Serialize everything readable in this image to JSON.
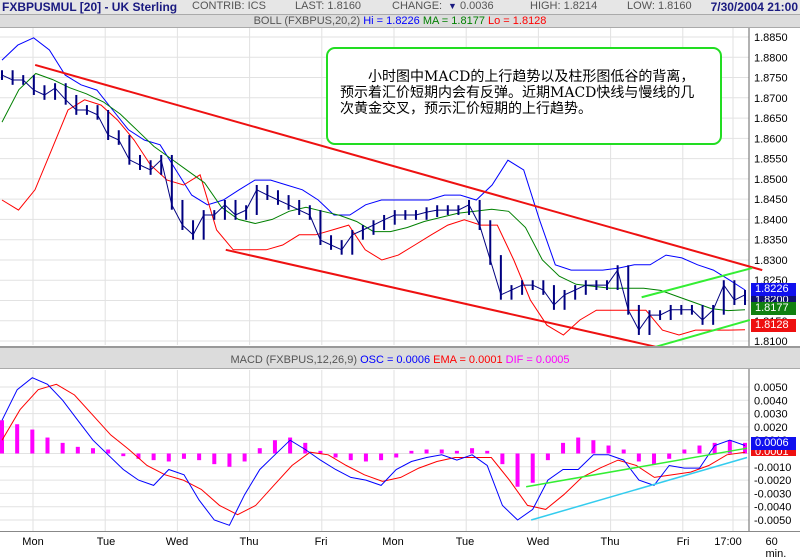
{
  "header": {
    "title": "FXBPUSMUL [20] - UK Sterling",
    "contrib": "CONTRIB: ICS",
    "last": "LAST: 1.8160",
    "change_label": "CHANGE:",
    "change_icon": "triangle-down-icon",
    "change_value": "0.0036",
    "high": "HIGH: 1.8214",
    "low": "LOW: 1.8160",
    "datetime": "7/30/2004 21:00"
  },
  "boll_bar": {
    "label": "BOLL (FXBPUS,20,2)",
    "hi": "Hi = 1.8226",
    "ma": "MA = 1.8177",
    "lo": "Lo = 1.8128"
  },
  "macd_bar": {
    "label": "MACD (FXBPUS,12,26,9)",
    "osc": "OSC = 0.0006",
    "ema": "EMA = 0.0001",
    "dif": "DIF = 0.0005"
  },
  "annotation": "小时图中MACD的上行趋势以及柱形图低谷的背离，预示着汇价短期内会有反弹。近期MACD快线与慢线的几次黄金交叉，预示汇价短期的上行趋势。",
  "price_boxes": [
    {
      "text": "1.8226",
      "color": "#1010ee"
    },
    {
      "text": "1.8200",
      "color": "#101070"
    },
    {
      "text": "1.8177",
      "color": "#108010"
    },
    {
      "text": "1.8128",
      "color": "#ee1010"
    }
  ],
  "macd_boxes": [
    {
      "text": "0.0006",
      "color": "#1010ee"
    },
    {
      "text": "0.0001",
      "color": "#ee1010"
    }
  ],
  "colors": {
    "price": "#000080",
    "boll_upper": "#0000ff",
    "boll_ma": "#008000",
    "boll_lower": "#ff0000",
    "channel": "#ee1111",
    "green_trend": "#33ee33",
    "cyan_trend": "#33ccee",
    "osc": "#0000ff",
    "ema": "#ff0000",
    "hist": "#ff00ff"
  },
  "chart_data": [
    {
      "type": "line",
      "panel": "price",
      "x_tick_labels": [
        "Mon",
        "Tue",
        "Wed",
        "Thu",
        "Fri",
        "Mon",
        "Tue",
        "Wed",
        "Thu",
        "Fri",
        "17:00"
      ],
      "x_unit_label": "60 min.",
      "y_ticks": [
        "1.8100",
        "1.8150",
        "1.8200",
        "1.8250",
        "1.8300",
        "1.8350",
        "1.8400",
        "1.8450",
        "1.8500",
        "1.8550",
        "1.8600",
        "1.8650",
        "1.8700",
        "1.8750",
        "1.8800",
        "1.8850"
      ],
      "ylim": [
        1.81,
        1.885
      ],
      "grid": true,
      "close": [
        1.8756,
        1.8744,
        1.8744,
        1.8719,
        1.8707,
        1.8724,
        1.8695,
        1.867,
        1.867,
        1.8658,
        1.8608,
        1.8596,
        1.8547,
        1.8534,
        1.8522,
        1.8547,
        1.8436,
        1.8386,
        1.8362,
        1.8411,
        1.8411,
        1.8436,
        1.8411,
        1.8423,
        1.8473,
        1.846,
        1.8448,
        1.8436,
        1.8423,
        1.8411,
        1.8349,
        1.8337,
        1.8325,
        1.8362,
        1.8374,
        1.8386,
        1.8399,
        1.8411,
        1.8411,
        1.8411,
        1.8418,
        1.8423,
        1.8423,
        1.8423,
        1.8436,
        1.8386,
        1.83,
        1.8214,
        1.8226,
        1.8238,
        1.8238,
        1.8226,
        1.8189,
        1.8214,
        1.8226,
        1.8238,
        1.8238,
        1.8238,
        1.8275,
        1.8177,
        1.8127,
        1.8164,
        1.8164,
        1.8177,
        1.8177,
        1.8177,
        1.8152,
        1.8177,
        1.8238,
        1.8201,
        1.8214
      ],
      "boll_upper": [
        1.8793,
        1.883,
        1.8848,
        1.8818,
        1.8756,
        1.8732,
        1.8719,
        1.867,
        1.8621,
        1.8596,
        1.8584,
        1.8522,
        1.846,
        1.8436,
        1.8448,
        1.8473,
        1.8497,
        1.8497,
        1.8485,
        1.8473,
        1.8448,
        1.8411,
        1.8411,
        1.8436,
        1.8448,
        1.8448,
        1.8448,
        1.8448,
        1.846,
        1.846,
        1.8448,
        1.8485,
        1.8546,
        1.8522,
        1.8399,
        1.8288,
        1.8275,
        1.8275,
        1.8275,
        1.828,
        1.8288,
        1.8288,
        1.8312,
        1.8305,
        1.8288,
        1.8275,
        1.8251,
        1.8226
      ],
      "boll_ma": [
        1.864,
        1.872,
        1.876,
        1.8745,
        1.8725,
        1.871,
        1.869,
        1.866,
        1.862,
        1.858,
        1.855,
        1.852,
        1.849,
        1.843,
        1.84,
        1.839,
        1.84,
        1.842,
        1.843,
        1.842,
        1.841,
        1.8395,
        1.837,
        1.837,
        1.838,
        1.8395,
        1.8405,
        1.8415,
        1.842,
        1.8425,
        1.842,
        1.838,
        1.83,
        1.826,
        1.824,
        1.8235,
        1.823,
        1.823,
        1.823,
        1.8225,
        1.821,
        1.8195,
        1.818,
        1.8175,
        1.8177
      ],
      "boll_lower": [
        1.8448,
        1.8423,
        1.8473,
        1.8571,
        1.867,
        1.8695,
        1.8682,
        1.8645,
        1.8596,
        1.8534,
        1.8497,
        1.8485,
        1.851,
        1.8374,
        1.8325,
        1.8325,
        1.8325,
        1.8337,
        1.8362,
        1.8362,
        1.8374,
        1.8386,
        1.8325,
        1.83,
        1.8312,
        1.8337,
        1.8362,
        1.8386,
        1.8399,
        1.8386,
        1.8386,
        1.83,
        1.8201,
        1.8139,
        1.8115,
        1.8152,
        1.8176,
        1.8176,
        1.8176,
        1.8176,
        1.8127,
        1.8115,
        1.8127,
        1.8127,
        1.8127,
        1.8128
      ],
      "trendlines": [
        {
          "kind": "channel-upper",
          "color": "#ee1111",
          "points": [
            [
              0.03,
              1.8781
            ],
            [
              10.1,
              1.8275
            ]
          ]
        },
        {
          "kind": "channel-lower",
          "color": "#ee1111",
          "points": [
            [
              2.67,
              1.8325
            ],
            [
              9.12,
              1.8066
            ]
          ]
        },
        {
          "kind": "wedge-upper",
          "color": "#33ee33",
          "points": [
            [
              8.43,
              1.8208
            ],
            [
              9.96,
              1.828
            ]
          ]
        },
        {
          "kind": "wedge-lower",
          "color": "#33ee33",
          "points": [
            [
              8.57,
              1.8083
            ],
            [
              9.93,
              1.8152
            ]
          ]
        }
      ]
    },
    {
      "type": "line",
      "panel": "macd",
      "y_ticks": [
        "-0.0050",
        "-0.0040",
        "-0.0030",
        "-0.0020",
        "-0.0010",
        "0.0000",
        "0.0010",
        "0.0020",
        "0.0030",
        "0.0040",
        "0.0050"
      ],
      "ylim": [
        -0.005,
        0.005
      ],
      "grid": true,
      "osc": [
        0.0025,
        0.0048,
        0.0057,
        0.0052,
        0.004,
        0.0025,
        0.001,
        -0.0001,
        -0.0012,
        -0.002,
        -0.0024,
        -0.0012,
        -0.0016,
        -0.0035,
        -0.005,
        -0.0054,
        -0.0031,
        -0.0012,
        -0.0001,
        0.001,
        0.0003,
        -0.0005,
        -0.0012,
        -0.0018,
        -0.002,
        -0.0024,
        -0.0012,
        -0.0006,
        -0.0003,
        -0.0001,
        -0.0005,
        -0.0001,
        -0.0009,
        -0.0039,
        -0.005,
        -0.0042,
        -0.002,
        -0.0012,
        -0.0012,
        -0.0001,
        -0.0001,
        -0.0005,
        -0.002,
        -0.0024,
        -0.0009,
        -0.0011,
        -0.0011,
        0.0006,
        0.001,
        0.0006
      ],
      "ema": [
        0.001,
        0.0033,
        0.0048,
        0.0052,
        0.0044,
        0.0029,
        0.0014,
        0.0003,
        -0.0009,
        -0.0016,
        -0.002,
        -0.0027,
        -0.0039,
        -0.0046,
        -0.0039,
        -0.0024,
        -0.0009,
        0.0001,
        -0.0001,
        -0.0009,
        -0.0016,
        -0.0021,
        -0.0018,
        -0.0011,
        -0.0006,
        -0.0003,
        -0.0003,
        -0.0003,
        -0.002,
        -0.0039,
        -0.0042,
        -0.0031,
        -0.0018,
        -0.0011,
        -0.0005,
        -0.0009,
        -0.0018,
        -0.0016,
        -0.0014,
        -0.0009,
        -0.0001,
        0.0001
      ],
      "histogram": [
        0.0025,
        0.0022,
        0.0018,
        0.0012,
        0.0008,
        0.0005,
        0.0004,
        0.0003,
        -0.0002,
        -0.0004,
        -0.0005,
        -0.0006,
        -0.0004,
        -0.0005,
        -0.0008,
        -0.001,
        -0.0006,
        0.0004,
        0.001,
        0.0012,
        0.0008,
        0.0002,
        -0.0003,
        -0.0005,
        -0.0006,
        -0.0005,
        -0.0003,
        0.0002,
        0.0003,
        0.0003,
        0.0002,
        0.0004,
        0.0002,
        -0.0008,
        -0.0025,
        -0.0022,
        -0.0005,
        0.0008,
        0.0012,
        0.001,
        0.0006,
        0.0003,
        -0.0006,
        -0.0008,
        -0.0004,
        0.0003,
        0.0006,
        0.0008,
        0.001,
        0.0008
      ],
      "trendlines": [
        {
          "kind": "green",
          "color": "#33ee33",
          "points": [
            [
              6.83,
              -0.0025
            ],
            [
              9.89,
              0.0004
            ]
          ]
        },
        {
          "kind": "cyan",
          "color": "#33ccee",
          "points": [
            [
              6.9,
              -0.005
            ],
            [
              9.89,
              -0.0003
            ]
          ]
        }
      ]
    }
  ]
}
